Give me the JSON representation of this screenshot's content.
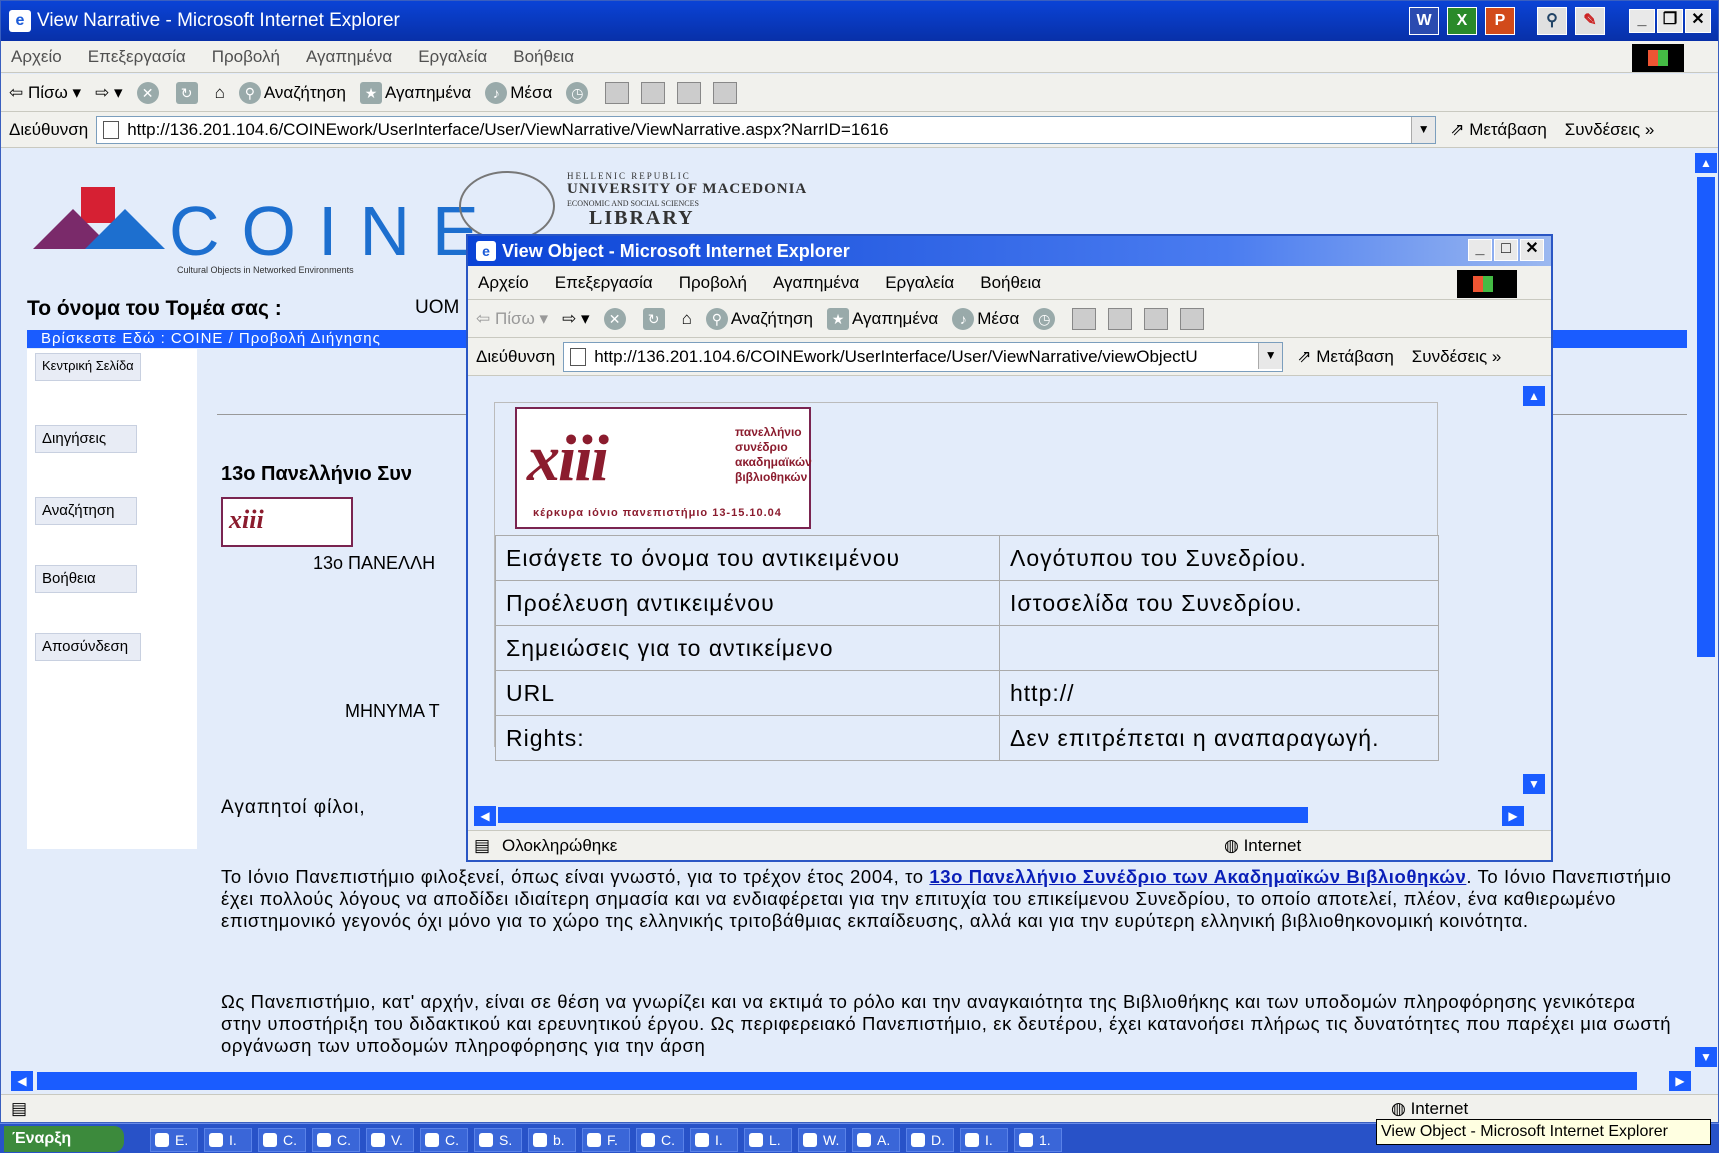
{
  "main_window": {
    "title": "View Narrative - Microsoft Internet Explorer",
    "menu": [
      "Αρχείο",
      "Επεξεργασία",
      "Προβολή",
      "Αγαπημένα",
      "Εργαλεία",
      "Βοήθεια"
    ],
    "toolbar": {
      "back": "Πίσω",
      "search": "Αναζήτηση",
      "favorites": "Αγαπημένα",
      "media": "Μέσα"
    },
    "address_label": "Διεύθυνση",
    "url": "http://136.201.104.6/COINEwork/UserInterface/User/ViewNarrative/ViewNarrative.aspx?NarrID=1616",
    "go_label": "Μετάβαση",
    "links_label": "Συνδέσεις",
    "status_zone": "Internet"
  },
  "page": {
    "coine_logo": {
      "word": "COINE",
      "subtitle": "Cultural Objects in Networked Environments"
    },
    "uom_logo": {
      "line1": "HELLENIC REPUBLIC",
      "line2": "UNIVERSITY OF MACEDONIA",
      "line3": "ECONOMIC AND SOCIAL SCIENCES",
      "line4": "LIBRARY"
    },
    "sector_label": "Το όνομα του Τομέα σας :",
    "sector_value": "UOM",
    "breadcrumb": "Βρίσκεστε Εδώ : COINE / Προβολή Διήγησης",
    "nav": [
      "Κεντρική Σελίδα",
      "Διηγήσεις",
      "Αναζήτηση",
      "Βοήθεια",
      "Αποσύνδεση"
    ],
    "narrative_title": "13ο Πανελλήνιο Συν",
    "thumb_logo": "xiii",
    "caps_title": "13ο ΠΑΝΕΛΛΗ",
    "caps_message": "ΜΗΝΥΜΑ Τ",
    "greeting": "Αγαπητοί φίλοι,",
    "para1_before": "Το Ιόνιο Πανεπιστήμιο φιλοξενεί, όπως είναι γνωστό, για το τρέχον έτος 2004, το ",
    "para1_link": "13ο Πανελλήνιο Συνέδριο των Ακαδημαϊκών Βιβλιοθηκών",
    "para1_after": ". Το Ιόνιο Πανεπιστήμιο έχει πολλούς λόγους να αποδίδει ιδιαίτερη σημασία και να ενδιαφέρεται για την επιτυχία του επικείμενου Συνεδρίου, το οποίο αποτελεί, πλέον, ένα καθιερωμένο επιστημονικό γεγονός όχι μόνο για το χώρο της ελληνικής τριτοβάθμιας εκπαίδευσης, αλλά και για την ευρύτερη ελληνική βιβλιοθηκονομική κοινότητα.",
    "para2": "Ως Πανεπιστήμιο, κατ' αρχήν, είναι σε θέση να γνωρίζει και να εκτιμά το ρόλο και την αναγκαιότητα της Βιβλιοθήκης και των υποδομών πληροφόρησης γενικότερα στην υποστήριξη του διδακτικού και ερευνητικού έργου. Ως περιφερειακό Πανεπιστήμιο, εκ δευτέρου, έχει κατανοήσει πλήρως τις δυνατότητες που παρέχει μια σωστή οργάνωση των υποδομών πληροφόρησης για την άρση"
  },
  "popup": {
    "title": "View Object - Microsoft Internet Explorer",
    "menu": [
      "Αρχείο",
      "Επεξεργασία",
      "Προβολή",
      "Αγαπημένα",
      "Εργαλεία",
      "Βοήθεια"
    ],
    "toolbar": {
      "back": "Πίσω",
      "search": "Αναζήτηση",
      "favorites": "Αγαπημένα",
      "media": "Μέσα"
    },
    "address_label": "Διεύθυνση",
    "url": "http://136.201.104.6/COINEwork/UserInterface/User/ViewNarrative/viewObjectU",
    "go_label": "Μετάβαση",
    "links_label": "Συνδέσεις",
    "status_text": "Ολοκληρώθηκε",
    "status_zone": "Internet",
    "object_image": {
      "mark": "xiii",
      "text_lines": [
        "πανελλήνιο",
        "συνέδριο",
        "ακαδημαϊκών",
        "βιβλιοθηκών"
      ],
      "bottom": "κέρκυρα   ιόνιο πανεπιστήμιο   13-15.10.04"
    },
    "properties": [
      {
        "key": "Εισάγετε το όνομα του αντικειμένου",
        "value": "Λογότυπου του Συνεδρίου."
      },
      {
        "key": "Προέλευση αντικειμένου",
        "value": "Ιστοσελίδα του Συνεδρίου."
      },
      {
        "key": "Σημειώσεις για το αντικείμενο",
        "value": ""
      },
      {
        "key": "URL",
        "value": "http://"
      },
      {
        "key": "Rights:",
        "value": "Δεν επιτρέπεται η αναπαραγωγή."
      }
    ]
  },
  "taskbar": {
    "start_label": "Έναρξη",
    "items": [
      "E.",
      "I.",
      "C.",
      "C.",
      "V.",
      "C.",
      "S.",
      "b.",
      "F.",
      "C.",
      "I.",
      "L.",
      "W.",
      "A.",
      "D.",
      "I.",
      "1."
    ],
    "tooltip": "View Object - Microsoft Internet Explorer"
  },
  "colors": {
    "title_blue": "#0a43d6",
    "scroll_blue": "#1a5cff",
    "page_bg": "#e3ecfa",
    "logo_maroon": "#8b1c2e",
    "link_blue": "#0a1fb8"
  }
}
